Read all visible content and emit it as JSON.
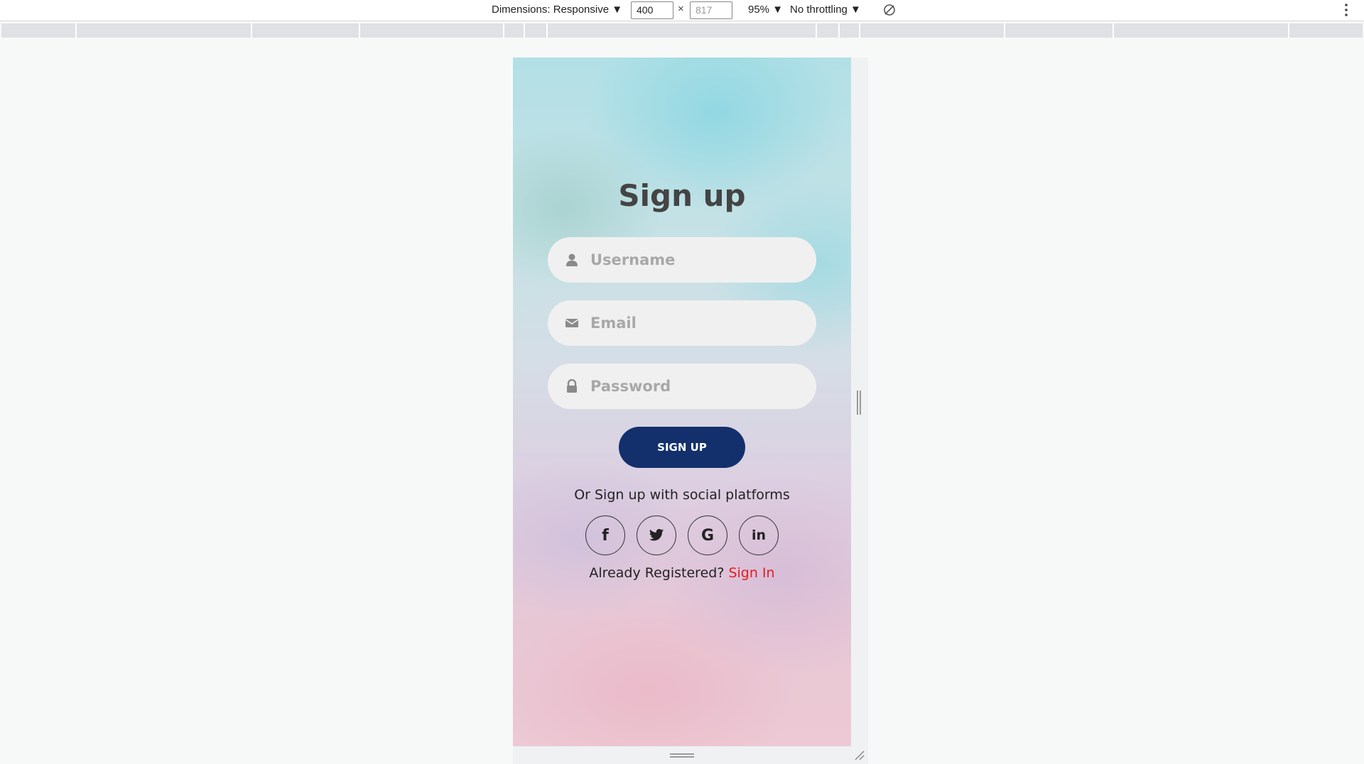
{
  "devtools": {
    "dimensions_label": "Dimensions: Responsive ▼",
    "width_value": "400",
    "height_value": "817",
    "times": "×",
    "zoom": "95% ▼",
    "throttling": "No throttling ▼"
  },
  "form": {
    "title": "Sign up",
    "username_placeholder": "Username",
    "email_placeholder": "Email",
    "password_placeholder": "Password",
    "submit_label": "SIGN UP",
    "social_text": "Or Sign up with social platforms",
    "social": {
      "facebook": "f",
      "google": "G",
      "linkedin": "in"
    },
    "already_text": "Already Registered?",
    "signin_label": "Sign In"
  },
  "colors": {
    "button": "#13306d",
    "signin_link": "#e41b23",
    "field_bg": "#f0f0f0"
  },
  "icons": [
    "user-icon",
    "envelope-icon",
    "lock-icon",
    "facebook-icon",
    "twitter-icon",
    "google-icon",
    "linkedin-icon",
    "rotate-icon",
    "more-vert-icon"
  ]
}
